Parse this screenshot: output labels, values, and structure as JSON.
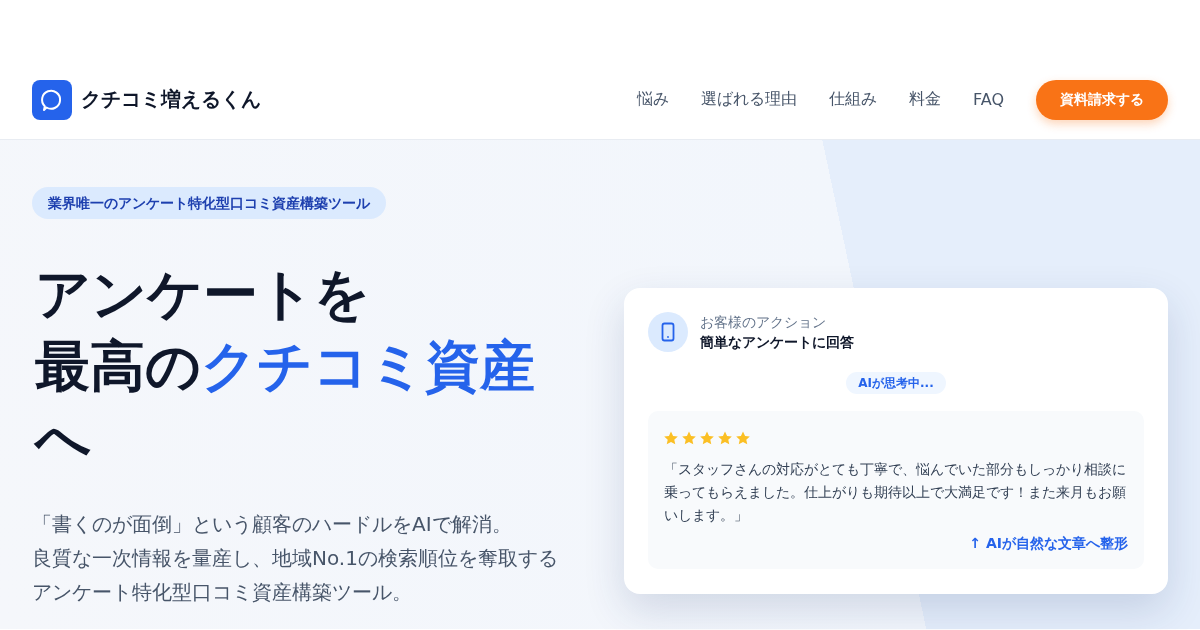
{
  "header": {
    "brand": "クチコミ増えるくん",
    "nav": [
      "悩み",
      "選ばれる理由",
      "仕組み",
      "料金",
      "FAQ"
    ],
    "cta": "資料請求する"
  },
  "hero": {
    "badge": "業界唯一のアンケート特化型口コミ資産構築ツール",
    "headline": {
      "lines": [
        {
          "segments": [
            {
              "text": "アンケートを",
              "highlight": false
            }
          ]
        },
        {
          "segments": [
            {
              "text": "最高の",
              "highlight": false
            },
            {
              "text": "クチコミ資産",
              "highlight": true
            }
          ]
        },
        {
          "segments": [
            {
              "text": "へ",
              "highlight": false
            }
          ]
        }
      ]
    },
    "description": [
      "「書くのが面倒」という顧客のハードルをAIで解消。",
      "良質な一次情報を量産し、地域No.1の検索順位を奪取する",
      "アンケート特化型口コミ資産構築ツール。"
    ]
  },
  "flow_card": {
    "step_label": "お客様のアクション",
    "step_title": "簡単なアンケートに回答",
    "status": "AIが思考中...",
    "review": {
      "stars": 5,
      "text": "「スタッフさんの対応がとても丁寧で、悩んでいた部分もしっかり相談に乗ってもらえました。仕上がりも期待以上で大満足です！また来月もお願いします。」",
      "note": "↑ AIが自然な文章へ整形"
    }
  }
}
